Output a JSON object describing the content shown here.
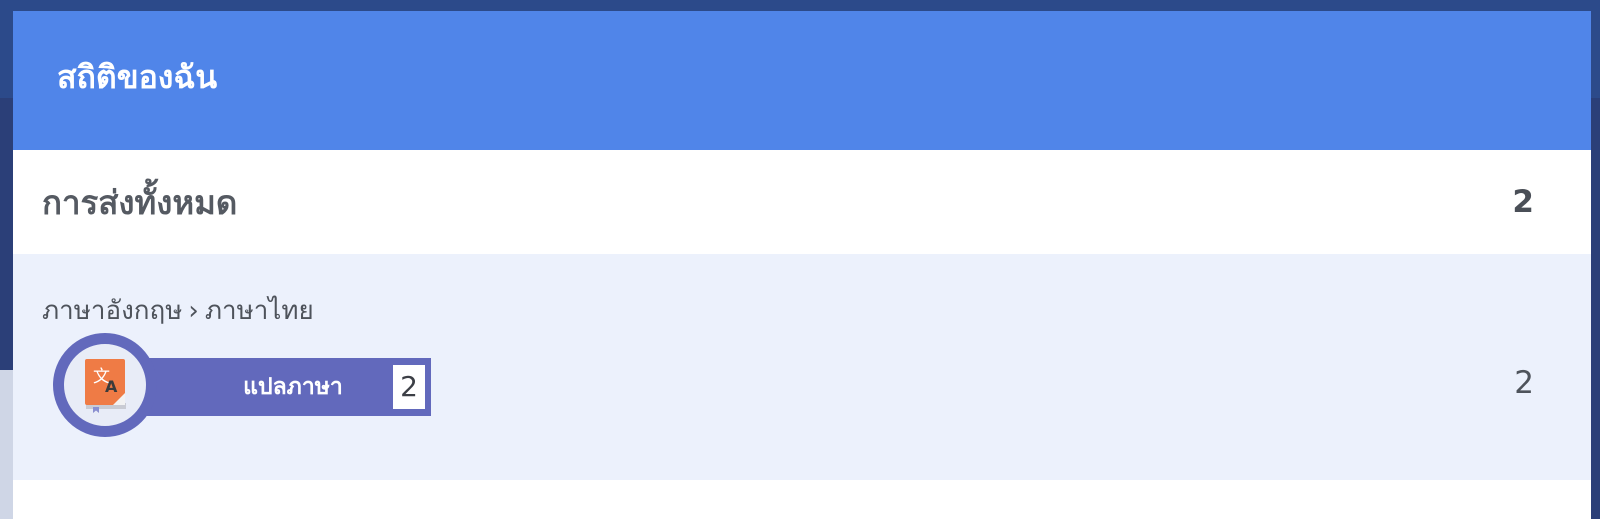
{
  "modal": {
    "title": "สถิติของฉัน"
  },
  "total": {
    "label": "การส่งทั้งหมด",
    "value": "2"
  },
  "language_pair": {
    "source": "ภาษาอังกฤษ",
    "separator": "›",
    "target": "ภาษาไทย",
    "value": "2",
    "badge": {
      "label": "แปลภาษา",
      "count": "2",
      "icon": "translate-book-icon"
    }
  },
  "colors": {
    "header": "#5085e9",
    "section_bg": "#ecf1fc",
    "badge": "#6269bc",
    "icon_accent": "#ef7b45"
  }
}
